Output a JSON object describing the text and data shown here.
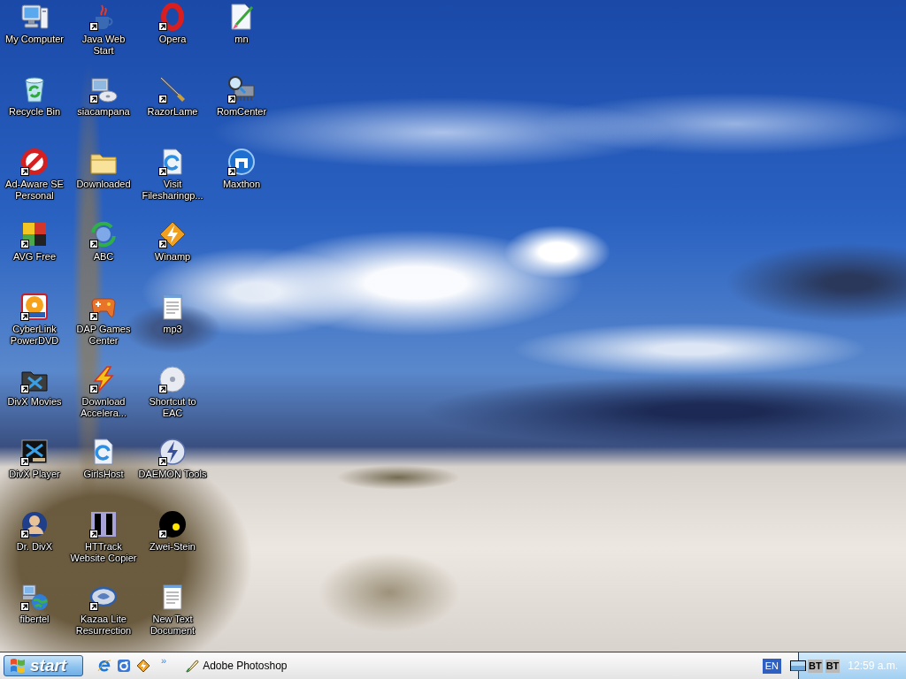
{
  "desktop_icons": [
    {
      "label": "My Computer",
      "shortcut": false
    },
    {
      "label": "Recycle Bin",
      "shortcut": false
    },
    {
      "label": "Ad-Aware SE Personal",
      "shortcut": true
    },
    {
      "label": "AVG Free",
      "shortcut": true
    },
    {
      "label": "CyberLink PowerDVD",
      "shortcut": true
    },
    {
      "label": "DivX Movies",
      "shortcut": true
    },
    {
      "label": "DivX Player",
      "shortcut": true
    },
    {
      "label": "Dr. DivX",
      "shortcut": true
    },
    {
      "label": "fibertel",
      "shortcut": true
    },
    {
      "label": "Java Web Start",
      "shortcut": true
    },
    {
      "label": "siacampana",
      "shortcut": true
    },
    {
      "label": "Downloaded",
      "shortcut": false
    },
    {
      "label": "ABC",
      "shortcut": true
    },
    {
      "label": "DAP Games Center",
      "shortcut": true
    },
    {
      "label": "Download Accelera...",
      "shortcut": true
    },
    {
      "label": "GirlsHost",
      "shortcut": false
    },
    {
      "label": "HTTrack Website Copier",
      "shortcut": true
    },
    {
      "label": "Kazaa Lite Resurrection",
      "shortcut": true
    },
    {
      "label": "Opera",
      "shortcut": true
    },
    {
      "label": "RazorLame",
      "shortcut": true
    },
    {
      "label": "Visit Filesharingp...",
      "shortcut": true
    },
    {
      "label": "Winamp",
      "shortcut": true
    },
    {
      "label": "mp3",
      "shortcut": false
    },
    {
      "label": "Shortcut to EAC",
      "shortcut": true
    },
    {
      "label": "DAEMON Tools",
      "shortcut": true
    },
    {
      "label": "Zwei-Stein",
      "shortcut": true
    },
    {
      "label": "New Text Document",
      "shortcut": false
    },
    {
      "label": "mn",
      "shortcut": false
    },
    {
      "label": "RomCenter",
      "shortcut": true
    },
    {
      "label": "Maxthon",
      "shortcut": true
    }
  ],
  "taskbar": {
    "start_button": "start",
    "quick_launch_more": "»",
    "tasks": [
      {
        "label": "Adobe Photoshop",
        "selected": false
      }
    ],
    "tray": {
      "language": "EN",
      "indicators": [
        "BT",
        "BT"
      ],
      "clock": "12:59 a.m."
    }
  }
}
